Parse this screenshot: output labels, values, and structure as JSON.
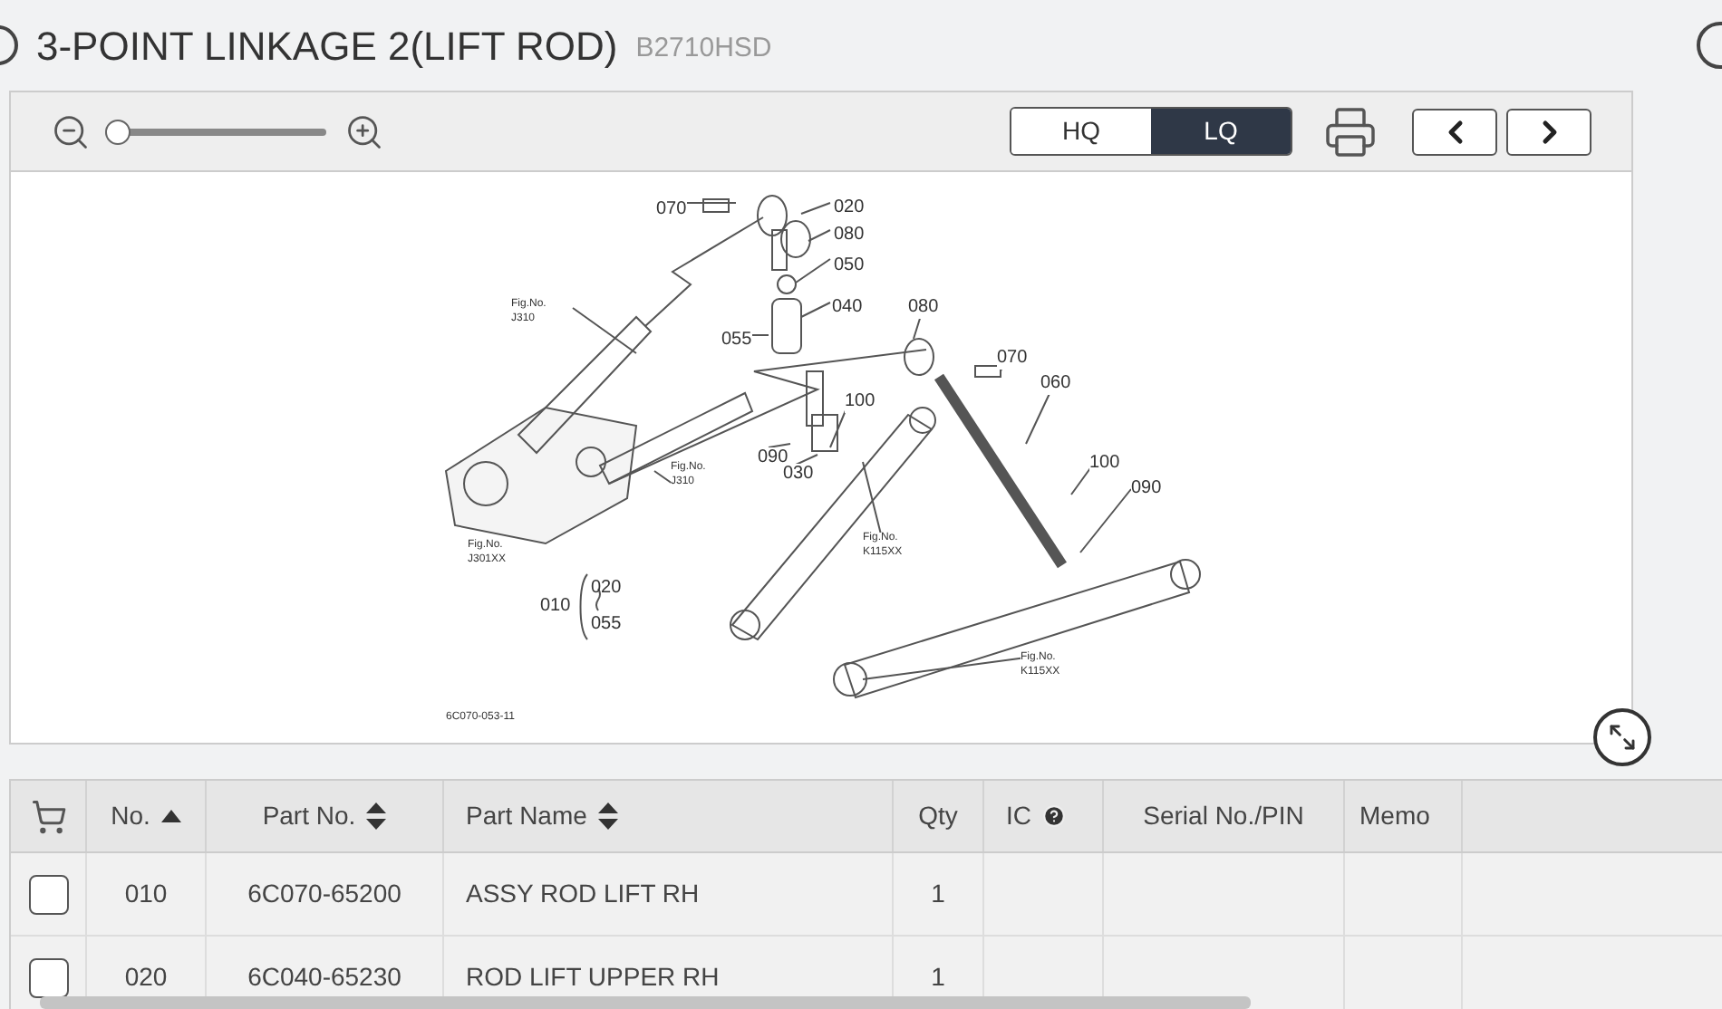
{
  "header": {
    "title": "3-POINT LINKAGE 2(LIFT ROD)",
    "model": "B2710HSD"
  },
  "viewer": {
    "zoom": {
      "level": 0
    },
    "quality": [
      {
        "label": "HQ",
        "selected": false
      },
      {
        "label": "LQ",
        "selected": true
      }
    ],
    "diagram": {
      "callouts": [
        "070",
        "020",
        "080",
        "050",
        "040",
        "055",
        "080",
        "070",
        "060",
        "100",
        "090",
        "030",
        "100",
        "090"
      ],
      "figure_refs": [
        {
          "caption": "Fig.No.",
          "ref": "J310"
        },
        {
          "caption": "Fig.No.",
          "ref": "J310"
        },
        {
          "caption": "Fig.No.",
          "ref": "J301XX"
        },
        {
          "caption": "Fig.No.",
          "ref": "K115XX"
        },
        {
          "caption": "Fig.No.",
          "ref": "K115XX"
        }
      ],
      "assembly": {
        "parent": "010",
        "from": "020",
        "to": "055"
      },
      "code": "6C070-053-11"
    }
  },
  "table": {
    "columns": [
      {
        "label": "No.",
        "kind": "ascending"
      },
      {
        "label": "Part No.",
        "kind": "sortable"
      },
      {
        "label": "Part Name",
        "kind": "sortable"
      },
      {
        "label": "Qty",
        "kind": "plain"
      },
      {
        "label": "IC",
        "kind": "help"
      },
      {
        "label": "Serial No./PIN",
        "kind": "plain"
      },
      {
        "label": "Memo",
        "kind": "plain"
      }
    ],
    "rows": [
      {
        "checked": false,
        "no": "010",
        "part_no": "6C070-65200",
        "name": "ASSY ROD LIFT RH",
        "qty": "1"
      },
      {
        "checked": false,
        "no": "020",
        "part_no": "6C040-65230",
        "name": "ROD LIFT UPPER RH",
        "qty": "1"
      }
    ]
  }
}
